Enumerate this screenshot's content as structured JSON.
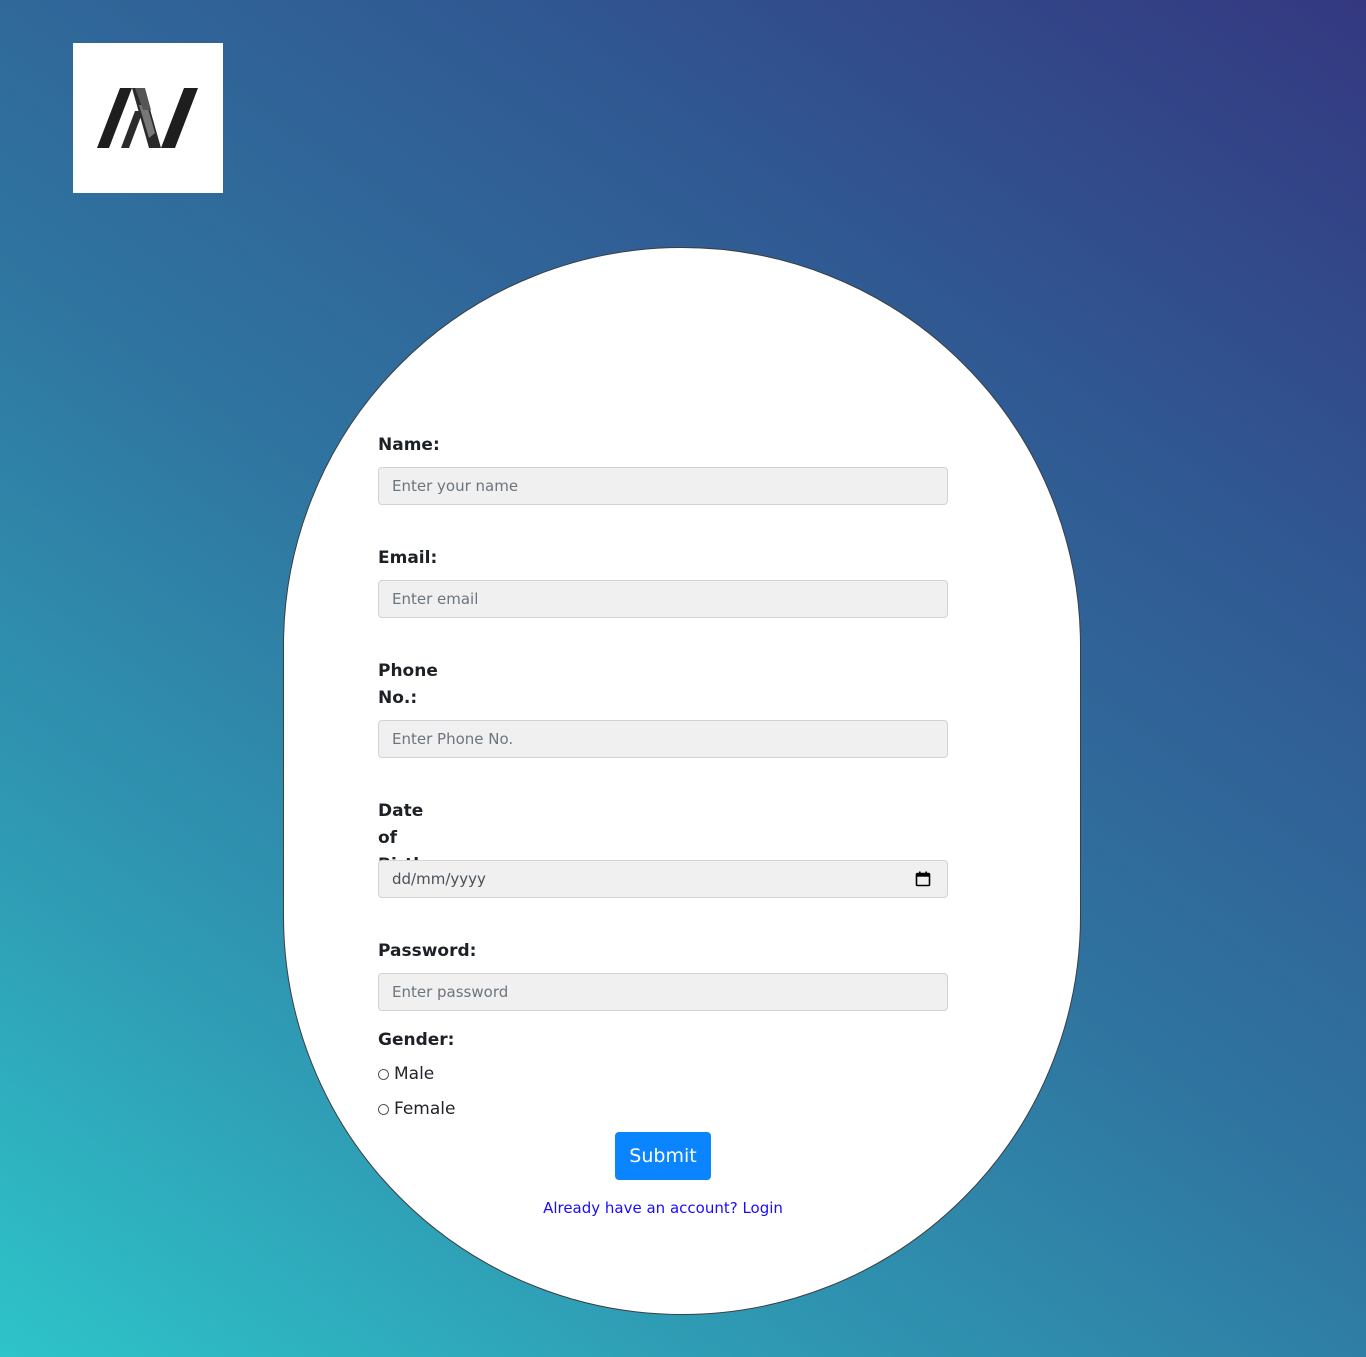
{
  "logo": {
    "icon": "n-monogram-logo"
  },
  "form": {
    "name": {
      "label": "Name:",
      "placeholder": "Enter your name"
    },
    "email": {
      "label": "Email:",
      "placeholder": "Enter email"
    },
    "phone": {
      "label": "Phone No.:",
      "placeholder": "Enter Phone No."
    },
    "dob": {
      "label": "Date of Birth:",
      "placeholder": "dd/mm/yyyy",
      "icon": "calendar-icon"
    },
    "password": {
      "label": "Password:",
      "placeholder": "Enter password"
    },
    "gender": {
      "label": "Gender:",
      "options": [
        "Male",
        "Female"
      ]
    },
    "submit_label": "Submit",
    "login_link": "Already have an account? Login"
  },
  "colors": {
    "background_start": "#2ec4c9",
    "background_end": "#343880",
    "submit_button": "#0a84ff",
    "link": "#1a0dff"
  }
}
